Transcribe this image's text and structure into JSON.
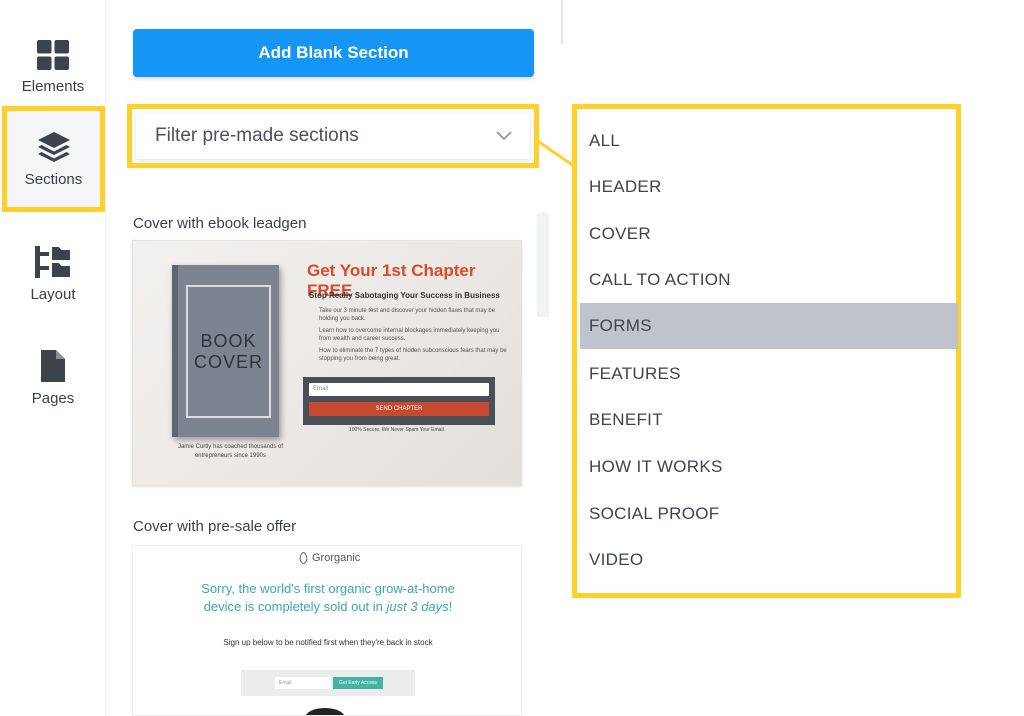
{
  "rail": {
    "items": [
      {
        "label": "Elements",
        "icon": "grid-icon"
      },
      {
        "label": "Sections",
        "icon": "layers-icon"
      },
      {
        "label": "Layout",
        "icon": "layout-tree-icon"
      },
      {
        "label": "Pages",
        "icon": "page-icon"
      }
    ],
    "active": "Sections"
  },
  "panel": {
    "add_button": "Add Blank Section",
    "filter_placeholder": "Filter pre-made sections",
    "cards": [
      {
        "title": "Cover with ebook leadgen",
        "preview": {
          "book_line1": "BOOK",
          "book_line2": "COVER",
          "headline": "Get Your 1st Chapter FREE",
          "subheadline": "Stop Really Sabotaging Your Success in Business",
          "bullets": [
            "Take our 3 minute test and discover your hidden flaws that may be holding you back.",
            "Learn how to overcome internal blockages immediately keeping you from wealth and career success.",
            "How to eliminate the 7 types of hidden subconscious fears that may be stopping you from being great."
          ],
          "email_placeholder": "Email",
          "send_button": "SEND CHAPTER",
          "secure_note": "100% Secure. We Never Spam Your Email.",
          "coach_note": "Jamie Curtly has coached thousands of entrepreneurs since 1990s"
        }
      },
      {
        "title": "Cover with pre-sale offer",
        "preview": {
          "brand": "Grorganic",
          "headline_main": "Sorry, the world's first organic grow-at-home device is completely sold out in ",
          "headline_em": "just 3 days",
          "headline_end": "!",
          "subline": "Sign up below to be notified first when they're back in stock",
          "email_placeholder": "Email",
          "cta_button": "Get Early Access"
        }
      }
    ]
  },
  "dropdown": {
    "options": [
      "ALL",
      "HEADER",
      "COVER",
      "CALL TO ACTION",
      "FORMS",
      "FEATURES",
      "BENEFIT",
      "HOW IT WORKS",
      "SOCIAL PROOF",
      "VIDEO"
    ],
    "highlighted": "FORMS"
  },
  "colors": {
    "highlight_frame": "#ffd02a",
    "primary_button": "#1596f5",
    "hover_row": "#bfc3cb",
    "icon": "#3d434b"
  }
}
